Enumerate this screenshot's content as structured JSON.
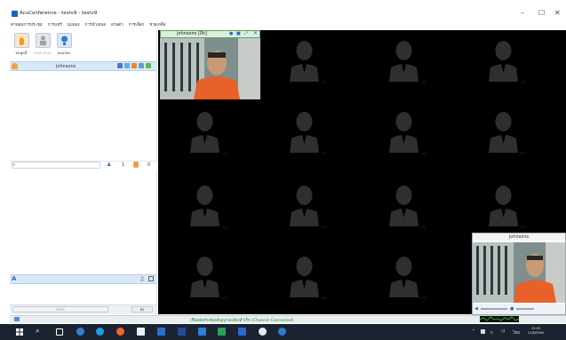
{
  "window": {
    "title": "AcuConference - testv9 - testv9",
    "minimize": "–",
    "maximize": "☐",
    "close": "✕"
  },
  "menu": [
    "ควบคุมการประชุม",
    "การแชร์",
    "มุมมอง",
    "การนำเสนอ",
    "ส่วนตัว",
    "การเลือก",
    "ช่วยเหลือ"
  ],
  "left_panel": {
    "big_buttons": [
      {
        "label": "ขอพูดนี้",
        "icon": "raise-hand-icon"
      },
      {
        "label": "ขอนำเสนอ",
        "icon": "presenter-icon"
      },
      {
        "label": "ขอแสดง",
        "icon": "bulb-icon"
      }
    ],
    "member_list_header": "johnsons",
    "member_count": "1",
    "hand_count": "0",
    "chat_input_placeholder": "บันทึก",
    "send_label": "ส่ง"
  },
  "video": {
    "main_title": "johnsons [0k]",
    "self_title": "johnsons",
    "slot_labels": [
      "3%",
      "4%",
      "5%",
      "6%",
      "7%",
      "8%",
      "9%",
      "10%",
      "11%",
      "12%",
      "13%",
      "14%",
      "15%",
      "16%",
      "17%",
      "18%"
    ]
  },
  "status": {
    "connection_text": "เชื่อมต่อกับช่องสัญญาณเสียงสำเร็จ (Channel Connected)"
  },
  "taskbar": {
    "time": "15:05",
    "date": "21/8/2560",
    "lang": "ไทย"
  },
  "colors": {
    "video_bg": "#000000",
    "silhouette": "#2f2f2f",
    "header_blue": "#d8e8f6",
    "status_green": "#2b8a2b",
    "taskbar": "#1b2330"
  }
}
